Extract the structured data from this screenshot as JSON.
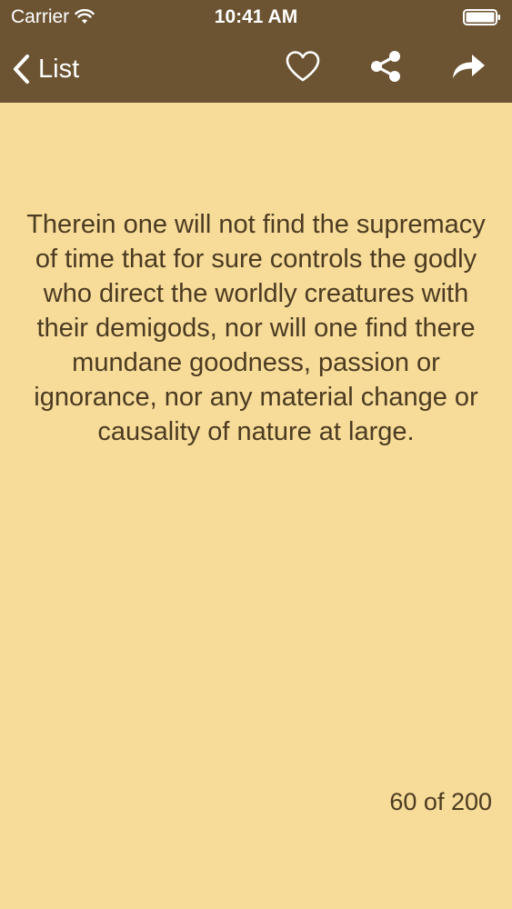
{
  "status_bar": {
    "carrier": "Carrier",
    "time": "10:41 AM"
  },
  "nav": {
    "back_label": "List",
    "icons": [
      "chevron-left-icon",
      "heart-icon",
      "share-icon",
      "forward-icon"
    ]
  },
  "content": {
    "quote": "Therein one will not find the supremacy of time that for sure controls the godly who direct the worldly creatures with their demigods, nor will one find there mundane goodness, passion or ignorance, nor any material change or causality of nature at large.",
    "counter": "60 of 200"
  },
  "colors": {
    "bar_background": "#6c5433",
    "page_background": "#f6dc98",
    "text": "#4c3a22",
    "bar_foreground": "#ffffff"
  }
}
